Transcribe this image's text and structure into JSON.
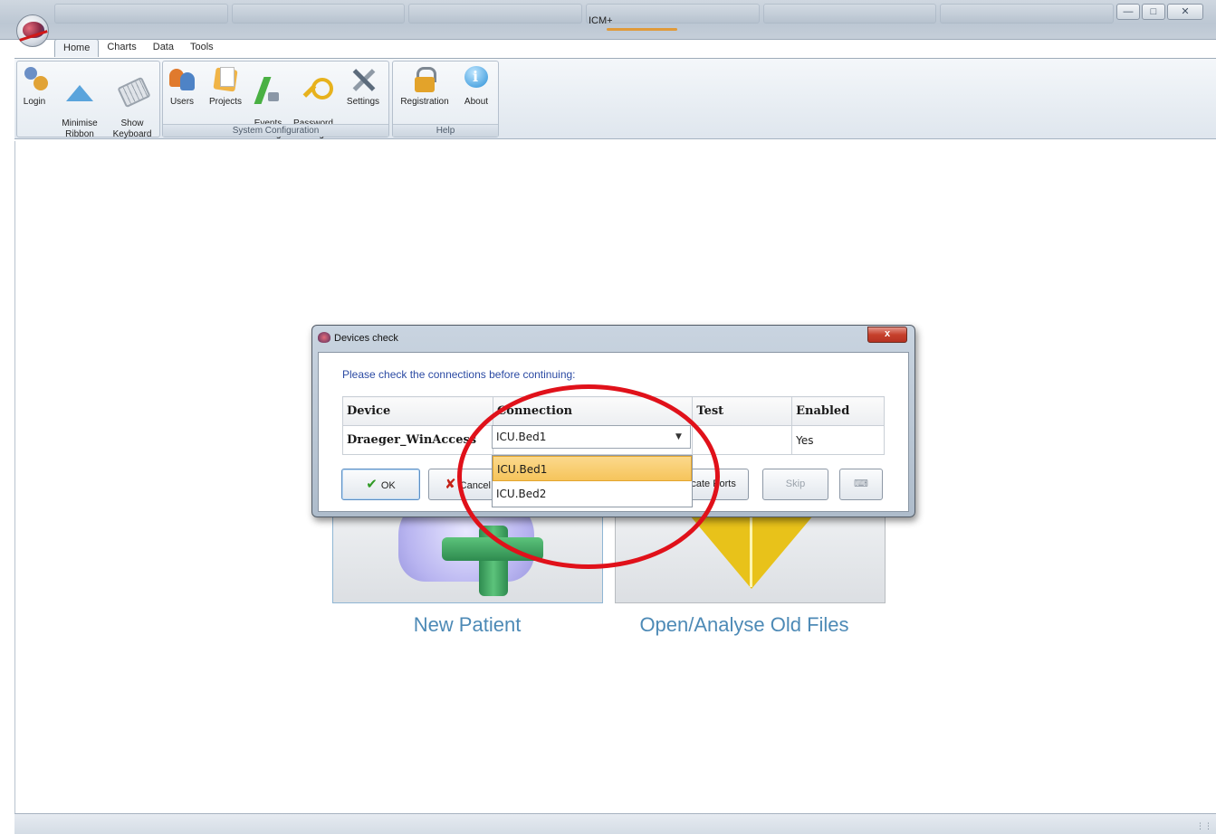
{
  "window": {
    "title": "ICM+",
    "controls": [
      "minimise",
      "maximise",
      "close"
    ]
  },
  "ribbon": {
    "tabs": [
      "Home",
      "Charts",
      "Data",
      "Tools"
    ],
    "active_tab": "Home",
    "groups": [
      {
        "caption": "",
        "buttons": [
          {
            "label": "Login",
            "icon": "login-icon"
          },
          {
            "label": "Minimise\nRibbon",
            "icon": "minimise-ribbon-icon"
          },
          {
            "label": "Show\nKeyboard",
            "icon": "keyboard-icon"
          }
        ]
      },
      {
        "caption": "System Configuration",
        "buttons": [
          {
            "label": "Users",
            "icon": "users-icon"
          },
          {
            "label": "Projects",
            "icon": "projects-icon"
          },
          {
            "label": "Events\nConfig",
            "icon": "events-icon"
          },
          {
            "label": "Password\nChange",
            "icon": "key-icon"
          },
          {
            "label": "Settings",
            "icon": "tools-icon"
          }
        ]
      },
      {
        "caption": "Help",
        "buttons": [
          {
            "label": "Registration",
            "icon": "lock-icon"
          },
          {
            "label": "About",
            "icon": "info-icon"
          }
        ]
      }
    ]
  },
  "home": {
    "new_patient": "New Patient",
    "open_old_files": "Open/Analyse Old Files"
  },
  "dialog": {
    "title": "Devices check",
    "close": "x",
    "prompt": "Please check the connections before continuing:",
    "columns": [
      "Device",
      "Connection",
      "Test",
      "Enabled"
    ],
    "row": {
      "device": "Draeger_WinAccess",
      "connection": "ICU.Bed1",
      "test": "",
      "enabled": "Yes"
    },
    "dropdown_options": [
      "ICU.Bed1",
      "ICU.Bed2"
    ],
    "dropdown_selected": "ICU.Bed1",
    "buttons": {
      "ok": "OK",
      "cancel": "Cancel",
      "locate": "Locate Ports",
      "skip": "Skip"
    }
  },
  "colors": {
    "annotation_circle": "#e0111a",
    "prompt_text": "#2b4aa3",
    "tile_caption": "#4d8ab6",
    "dropdown_highlight": "#f6c45b"
  }
}
